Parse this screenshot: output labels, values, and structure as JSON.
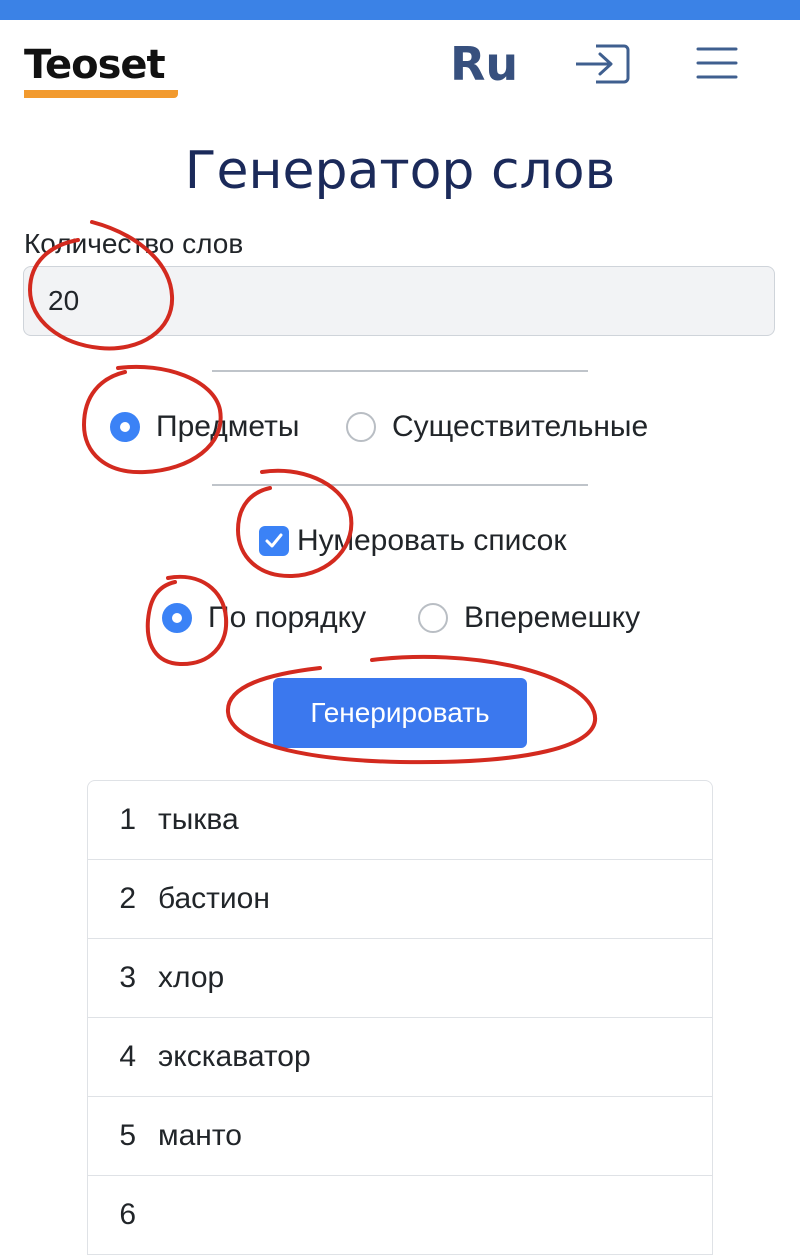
{
  "header": {
    "logo": "Teoset",
    "language": "Ru",
    "icons": {
      "login": "login-icon",
      "menu": "hamburger-menu-icon"
    }
  },
  "page": {
    "title": "Генератор слов"
  },
  "form": {
    "count_label": "Количество слов",
    "count_value": "20",
    "word_type": {
      "options": [
        "Предметы",
        "Существительные"
      ],
      "selected": "Предметы"
    },
    "numbering": {
      "label": "Нумеровать список",
      "checked": true
    },
    "order": {
      "options": [
        "По порядку",
        "Вперемешку"
      ],
      "selected": "По порядку"
    },
    "generate_label": "Генерировать"
  },
  "results": [
    {
      "num": "1",
      "word": "тыква"
    },
    {
      "num": "2",
      "word": "бастион"
    },
    {
      "num": "3",
      "word": "хлор"
    },
    {
      "num": "4",
      "word": "экскаватор"
    },
    {
      "num": "5",
      "word": "манто"
    },
    {
      "num": "6",
      "word": ""
    }
  ],
  "colors": {
    "accent": "#3b82f6",
    "button": "#3b78ee",
    "title": "#1b2a5a",
    "logo_underline": "#f29a2e",
    "annotation": "#d32a1f",
    "top_bar": "#3b82e6"
  }
}
